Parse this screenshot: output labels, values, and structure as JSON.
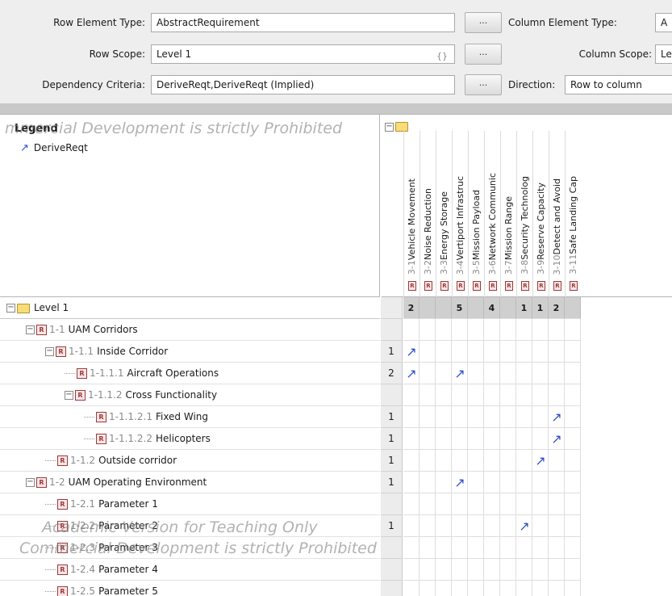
{
  "form": {
    "row_element_type_label": "Row Element Type:",
    "row_element_type_value": "AbstractRequirement",
    "row_scope_label": "Row Scope:",
    "row_scope_value": "Level 1",
    "dependency_criteria_label": "Dependency Criteria:",
    "dependency_criteria_value": "DeriveReqt,DeriveReqt (Implied)",
    "ellipsis": "...",
    "column_element_type_label": "Column Element Type:",
    "column_element_type_value": "A",
    "column_scope_label": "Column Scope:",
    "column_scope_value": "Le",
    "direction_label": "Direction:",
    "direction_value": "Row to column"
  },
  "legend": {
    "title": "Legend",
    "items": [
      {
        "label": "DeriveReqt",
        "icon": "derive-arrow-icon"
      }
    ]
  },
  "columns": [
    {
      "num": "3-1",
      "name": "Vehicle Movement",
      "count": "2"
    },
    {
      "num": "3-2",
      "name": "Noise Reduction",
      "count": ""
    },
    {
      "num": "3-3",
      "name": "Energy Storage",
      "count": ""
    },
    {
      "num": "3-4",
      "name": "Vertiport Infrastruc",
      "count": "5"
    },
    {
      "num": "3-5",
      "name": "Mission Payload",
      "count": ""
    },
    {
      "num": "3-6",
      "name": "Network Communic",
      "count": "4"
    },
    {
      "num": "3-7",
      "name": "Mission Range",
      "count": ""
    },
    {
      "num": "3-8",
      "name": "Security Technolog",
      "count": "1"
    },
    {
      "num": "3-9",
      "name": "Reserve Capacity",
      "count": "1"
    },
    {
      "num": "3-10",
      "name": "Detect and Avoid",
      "count": "2"
    },
    {
      "num": "3-11",
      "name": "Safe Landing Cap",
      "count": ""
    }
  ],
  "rows": [
    {
      "num": "",
      "name": "Level 1",
      "count": "",
      "depth": 0,
      "kind": "folder",
      "deps": []
    },
    {
      "num": "1-1",
      "name": "UAM Corridors",
      "count": "",
      "depth": 1,
      "kind": "req",
      "deps": []
    },
    {
      "num": "1-1.1",
      "name": "Inside Corridor",
      "count": "1",
      "depth": 2,
      "kind": "req",
      "deps": [
        0
      ]
    },
    {
      "num": "1-1.1.1",
      "name": "Aircraft Operations",
      "count": "2",
      "depth": 3,
      "kind": "req",
      "deps": [
        0,
        3
      ]
    },
    {
      "num": "1-1.1.2",
      "name": "Cross Functionality",
      "count": "",
      "depth": 3,
      "kind": "req",
      "deps": []
    },
    {
      "num": "1-1.1.2.1",
      "name": "Fixed Wing",
      "count": "1",
      "depth": 4,
      "kind": "req",
      "deps": [
        9
      ]
    },
    {
      "num": "1-1.1.2.2",
      "name": "Helicopters",
      "count": "1",
      "depth": 4,
      "kind": "req",
      "deps": [
        9
      ]
    },
    {
      "num": "1-1.2",
      "name": "Outside corridor",
      "count": "1",
      "depth": 2,
      "kind": "req",
      "deps": [
        8
      ]
    },
    {
      "num": "1-2",
      "name": "UAM Operating Environment",
      "count": "1",
      "depth": 1,
      "kind": "req",
      "deps": [
        3
      ]
    },
    {
      "num": "1-2.1",
      "name": "Parameter 1",
      "count": "",
      "depth": 2,
      "kind": "req",
      "deps": []
    },
    {
      "num": "1-2.2",
      "name": "Parameter 2",
      "count": "1",
      "depth": 2,
      "kind": "req",
      "deps": [
        7
      ]
    },
    {
      "num": "1-2.3",
      "name": "Parameter 3",
      "count": "",
      "depth": 2,
      "kind": "req",
      "deps": []
    },
    {
      "num": "1-2.4",
      "name": "Parameter 4",
      "count": "",
      "depth": 2,
      "kind": "req",
      "deps": []
    },
    {
      "num": "1-2.5",
      "name": "Parameter 5",
      "count": "",
      "depth": 2,
      "kind": "req",
      "deps": []
    }
  ],
  "watermarks": {
    "top": "mmercial Development is strictly Prohibited",
    "bottom1": "Academic Version for Teaching Only",
    "bottom2": "Commercial Development is strictly Prohibited"
  },
  "colors": {
    "accent": "#2a50c8",
    "req_box": "#9a3a3a"
  }
}
